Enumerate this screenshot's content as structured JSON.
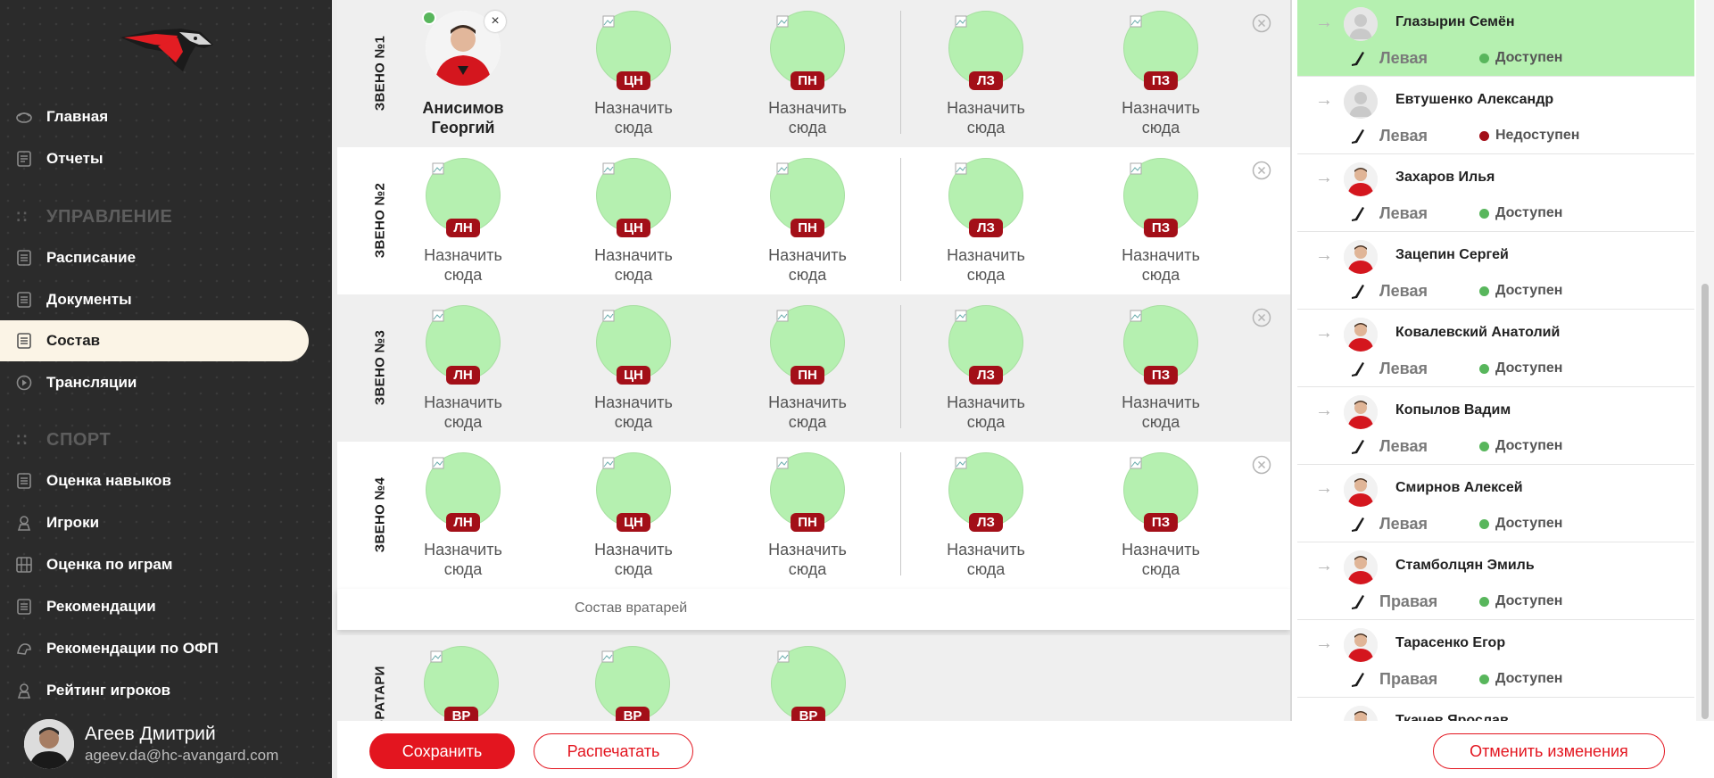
{
  "sidebar": {
    "items": [
      {
        "label": "Главная",
        "icon": "home-icon"
      },
      {
        "label": "Отчеты",
        "icon": "report-icon"
      },
      {
        "label": "Расписание",
        "icon": "schedule-icon"
      },
      {
        "label": "Документы",
        "icon": "document-icon"
      },
      {
        "label": "Состав",
        "icon": "roster-icon",
        "active": true
      },
      {
        "label": "Трансляции",
        "icon": "play-icon"
      },
      {
        "label": "Оценка навыков",
        "icon": "skills-icon"
      },
      {
        "label": "Игроки",
        "icon": "players-icon"
      },
      {
        "label": "Оценка по играм",
        "icon": "games-rating-icon"
      },
      {
        "label": "Рекомендации",
        "icon": "recommendations-icon"
      },
      {
        "label": "Рекомендации по ОФП",
        "icon": "fitness-icon"
      },
      {
        "label": "Рейтинг игроков",
        "icon": "rating-icon"
      }
    ],
    "sections": {
      "management": "УПРАВЛЕНИЕ",
      "sport": "СПОРТ"
    },
    "user": {
      "name": "Агеев Дмитрий",
      "email": "ageev.da@hc-avangard.com"
    }
  },
  "lines": [
    {
      "label": "ЗВЕНО №1"
    },
    {
      "label": "ЗВЕНО №2"
    },
    {
      "label": "ЗВЕНО №3"
    },
    {
      "label": "ЗВЕНО №4"
    }
  ],
  "positions": {
    "lw": "ЛН",
    "c": "ЦН",
    "rw": "ПН",
    "ld": "ЛЗ",
    "rd": "ПЗ",
    "g": "ВР"
  },
  "assign_text": [
    "Назначить",
    "сюда"
  ],
  "assigned_player": {
    "name_line1": "Анисимов",
    "name_line2": "Георгий",
    "close": "×"
  },
  "goalies": {
    "header": "Состав вратарей",
    "label": "ВРАТАРИ"
  },
  "buttons": {
    "save": "Сохранить",
    "print": "Распечатать",
    "cancel": "Отменить изменения"
  },
  "players": [
    {
      "name": "Глазырин Семён",
      "hand": "Левая",
      "status": "Доступен",
      "available": true,
      "highlight": true,
      "photo": false
    },
    {
      "name": "Евтушенко Александр",
      "hand": "Левая",
      "status": "Недоступен",
      "available": false,
      "photo": false
    },
    {
      "name": "Захаров Илья",
      "hand": "Левая",
      "status": "Доступен",
      "available": true,
      "photo": true
    },
    {
      "name": "Зацепин Сергей",
      "hand": "Левая",
      "status": "Доступен",
      "available": true,
      "photo": true
    },
    {
      "name": "Ковалевский Анатолий",
      "hand": "Левая",
      "status": "Доступен",
      "available": true,
      "photo": true
    },
    {
      "name": "Копылов Вадим",
      "hand": "Левая",
      "status": "Доступен",
      "available": true,
      "photo": true
    },
    {
      "name": "Смирнов Алексей",
      "hand": "Левая",
      "status": "Доступен",
      "available": true,
      "photo": true
    },
    {
      "name": "Стамболцян Эмиль",
      "hand": "Правая",
      "status": "Доступен",
      "available": true,
      "photo": true
    },
    {
      "name": "Тарасенко Егор",
      "hand": "Правая",
      "status": "Доступен",
      "available": true,
      "photo": true
    },
    {
      "name": "Ткачев Ярослав",
      "hand": "",
      "status": "",
      "available": true,
      "photo": true
    }
  ],
  "colors": {
    "accent": "#e3151f",
    "badge": "#a30f18",
    "slot": "#b5f0b0",
    "available": "#58b65c",
    "unavailable": "#a30f18"
  }
}
